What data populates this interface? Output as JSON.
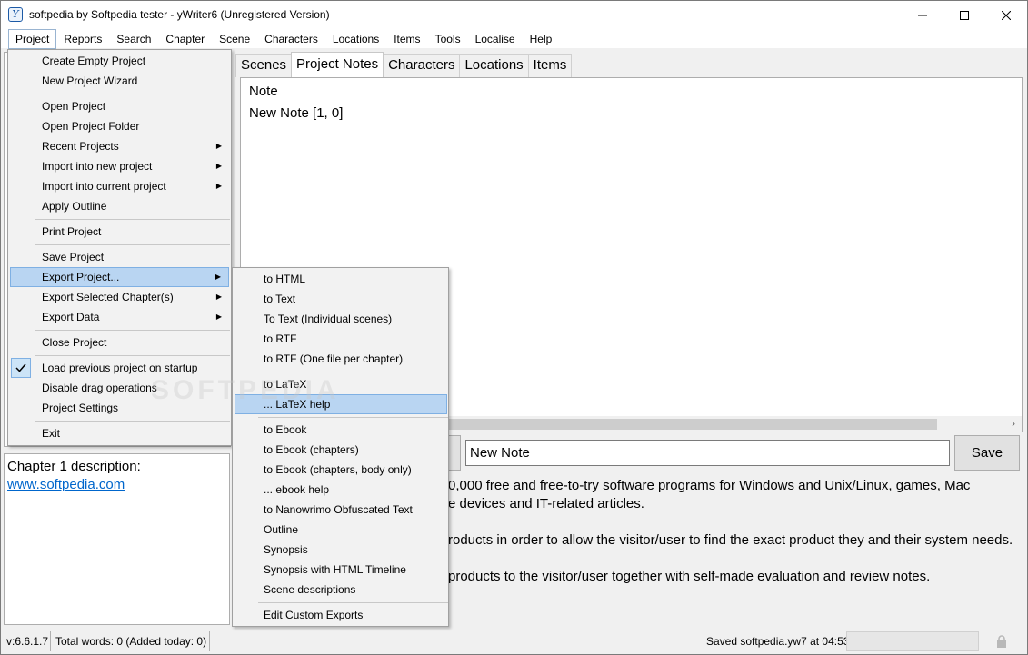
{
  "window": {
    "title": "softpedia by Softpedia tester - yWriter6 (Unregistered Version)"
  },
  "menubar": [
    "Project",
    "Reports",
    "Search",
    "Chapter",
    "Scene",
    "Characters",
    "Locations",
    "Items",
    "Tools",
    "Localise",
    "Help"
  ],
  "tabs": [
    "Scenes",
    "Project Notes",
    "Characters",
    "Locations",
    "Items"
  ],
  "notes": {
    "header": "Note",
    "items": [
      "New Note [1, 0]"
    ]
  },
  "note_editor": {
    "title_value": "New Note",
    "save_label": "Save"
  },
  "left_panel": {
    "chapter_description_label": "Chapter 1 description:",
    "link": "www.softpedia.com"
  },
  "note_body": [
    "0,000 free and free-to-try software programs for Windows and Unix/Linux, games, Mac",
    "e devices and IT-related articles.",
    "roducts in order to allow the visitor/user to find the exact product they and their system needs.",
    "products to the visitor/user together with self-made evaluation and review notes."
  ],
  "status": {
    "version": "v:6.6.1.7",
    "words": "Total words: 0 (Added today: 0)",
    "saved": "Saved softpedia.yw7 at 04:53"
  },
  "project_menu": {
    "items": [
      {
        "label": "Create Empty Project"
      },
      {
        "label": "New Project Wizard"
      },
      {
        "label": "Open Project"
      },
      {
        "label": "Open Project Folder"
      },
      {
        "label": "Recent Projects",
        "submenu": true
      },
      {
        "label": "Import into new project",
        "submenu": true
      },
      {
        "label": "Import into current project",
        "submenu": true
      },
      {
        "label": "Apply Outline"
      },
      {
        "label": "Print Project"
      },
      {
        "label": "Save Project"
      },
      {
        "label": "Export Project...",
        "submenu": true,
        "highlight": true
      },
      {
        "label": "Export Selected Chapter(s)",
        "submenu": true
      },
      {
        "label": "Export Data",
        "submenu": true
      },
      {
        "label": "Close Project"
      },
      {
        "label": "Load previous project on startup",
        "checked": true
      },
      {
        "label": "Disable drag operations"
      },
      {
        "label": "Project Settings"
      },
      {
        "label": "Exit"
      }
    ]
  },
  "export_submenu": {
    "items": [
      {
        "label": "to HTML"
      },
      {
        "label": "to Text"
      },
      {
        "label": "To Text (Individual scenes)"
      },
      {
        "label": "to RTF"
      },
      {
        "label": "to RTF (One file per chapter)"
      },
      {
        "label": "to LaTeX"
      },
      {
        "label": "... LaTeX help",
        "highlight": true
      },
      {
        "label": "to Ebook"
      },
      {
        "label": "to Ebook (chapters)"
      },
      {
        "label": "to Ebook (chapters, body only)"
      },
      {
        "label": "... ebook help"
      },
      {
        "label": "to Nanowrimo Obfuscated Text"
      },
      {
        "label": "Outline"
      },
      {
        "label": "Synopsis"
      },
      {
        "label": "Synopsis with HTML Timeline"
      },
      {
        "label": "Scene descriptions"
      },
      {
        "label": "Edit Custom Exports"
      }
    ]
  },
  "watermark": "SOFTPEDIA"
}
